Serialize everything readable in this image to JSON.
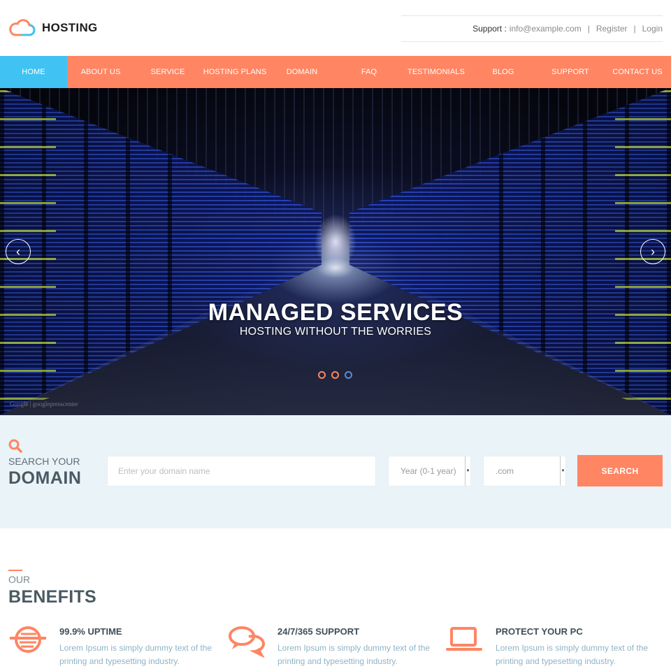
{
  "brand": {
    "name": "HOSTING",
    "accent": "#ff8563",
    "nav_active_color": "#40c3f2"
  },
  "topbar": {
    "support_label": "Support :",
    "support_email": "info@example.com",
    "register": "Register",
    "login": "Login",
    "separator": "|"
  },
  "nav": {
    "items": [
      {
        "label": "HOME"
      },
      {
        "label": "ABOUT US"
      },
      {
        "label": "SERVICE"
      },
      {
        "label": "HOSTING PLANS"
      },
      {
        "label": "DOMAIN"
      },
      {
        "label": "FAQ"
      },
      {
        "label": "TESTIMONIALS"
      },
      {
        "label": "BLOG"
      },
      {
        "label": "SUPPORT"
      },
      {
        "label": "CONTACT US"
      }
    ],
    "active": "HOME"
  },
  "hero": {
    "title": "MANAGED SERVICES",
    "subtitle": "HOSTING WITHOUT THE WORRIES",
    "prev_glyph": "‹",
    "next_glyph": "›",
    "slides": 3,
    "active_slide": 3,
    "credit": "Google | googlepresscenter"
  },
  "domain_search": {
    "title_small": "SEARCH YOUR",
    "title_big": "DOMAIN",
    "input_placeholder": "Enter your domain name",
    "year_select": "Year (0-1 year)",
    "tld_select": ".com",
    "button": "SEARCH"
  },
  "benefits": {
    "title_small": "OUR",
    "title_big": "BENEFITS",
    "items": [
      {
        "icon": "uptime-icon",
        "title": "99.9% UPTIME",
        "text": "Lorem Ipsum is simply dummy text of the printing and typesetting industry."
      },
      {
        "icon": "chat-bubbles-icon",
        "title": "24/7/365 SUPPORT",
        "text": "Lorem Ipsum is simply dummy text of the printing and typesetting industry."
      },
      {
        "icon": "laptop-icon",
        "title": "PROTECT YOUR PC",
        "text": "Lorem Ipsum is simply dummy text of the printing and typesetting industry."
      }
    ]
  }
}
